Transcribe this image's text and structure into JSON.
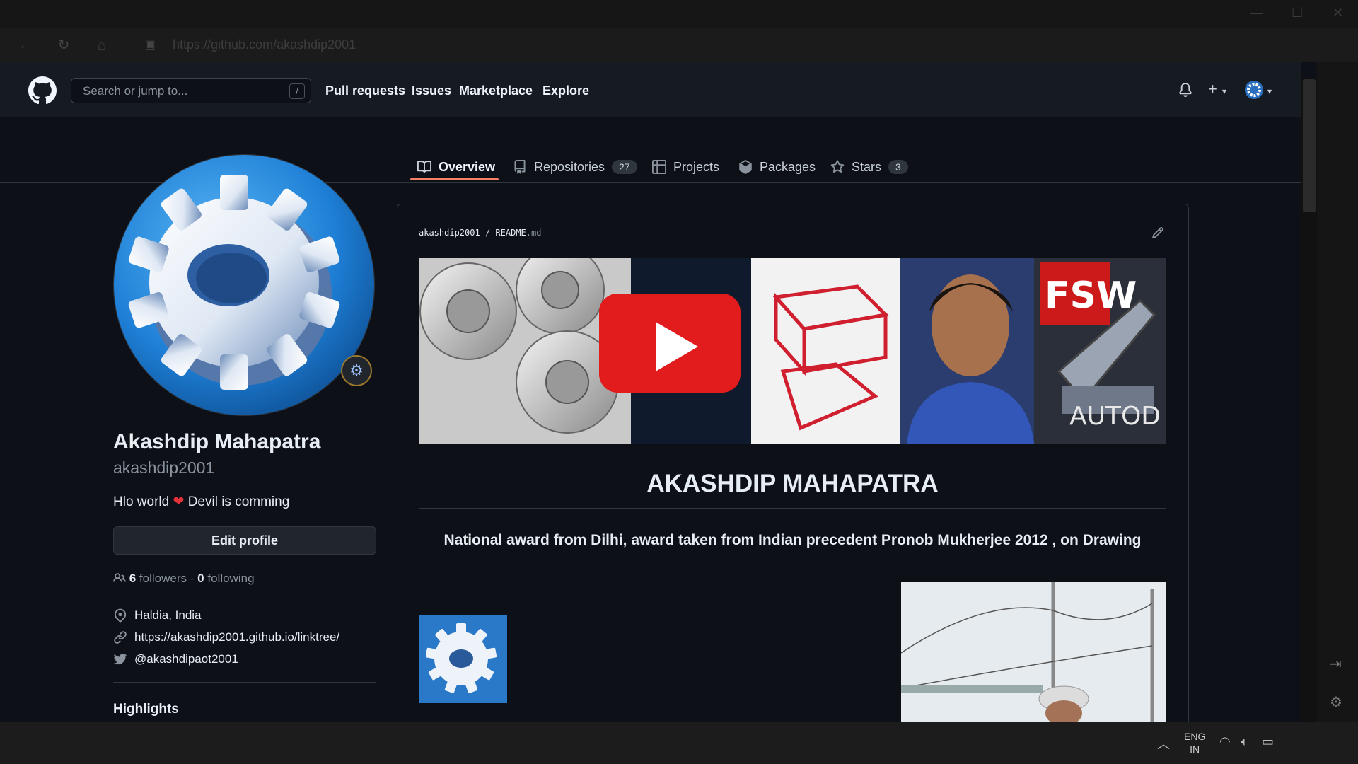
{
  "browser": {
    "url": "https://github.com/akashdip2001"
  },
  "header": {
    "search_placeholder": "Search or jump to...",
    "search_shortcut": "/",
    "nav": [
      "Pull requests",
      "Issues",
      "Marketplace",
      "Explore"
    ],
    "plus": "+",
    "caret": "▾"
  },
  "tabs": [
    {
      "label": "Overview",
      "active": true
    },
    {
      "label": "Repositories",
      "count": "27"
    },
    {
      "label": "Projects"
    },
    {
      "label": "Packages"
    },
    {
      "label": "Stars",
      "count": "3"
    }
  ],
  "profile": {
    "full_name": "Akashdip Mahapatra",
    "login": "akashdip2001",
    "bio_before": "Hlo world",
    "bio_heart": "❤",
    "bio_after": "Devil is comming",
    "edit_button": "Edit profile",
    "followers_count": "6",
    "followers_label": "followers",
    "separator": "·",
    "following_count": "0",
    "following_label": "following",
    "location": "Haldia, India",
    "website": "https://akashdip2001.github.io/linktree/",
    "twitter": "@akashdipaot2001",
    "highlights_heading": "Highlights"
  },
  "readme": {
    "owner": "akashdip2001",
    "slash": "/",
    "file_name": "README",
    "file_ext": ".md",
    "banner_text_autod": "AUTOD",
    "banner_text_fsw": "FSW",
    "heading": "AKASHDIP MAHAPATRA",
    "award_text": "National award from Dilhi, award taken from Indian precedent Pronob Mukherjee 2012 , on Drawing"
  },
  "taskbar": {
    "lang_line1": "ENG",
    "lang_line2": "IN"
  },
  "colors": {
    "bg": "#0d1117",
    "header_bg": "#161b22",
    "border": "#30363d",
    "tab_underline": "#f78166",
    "text": "#e6edf3",
    "muted": "#8b949e"
  }
}
